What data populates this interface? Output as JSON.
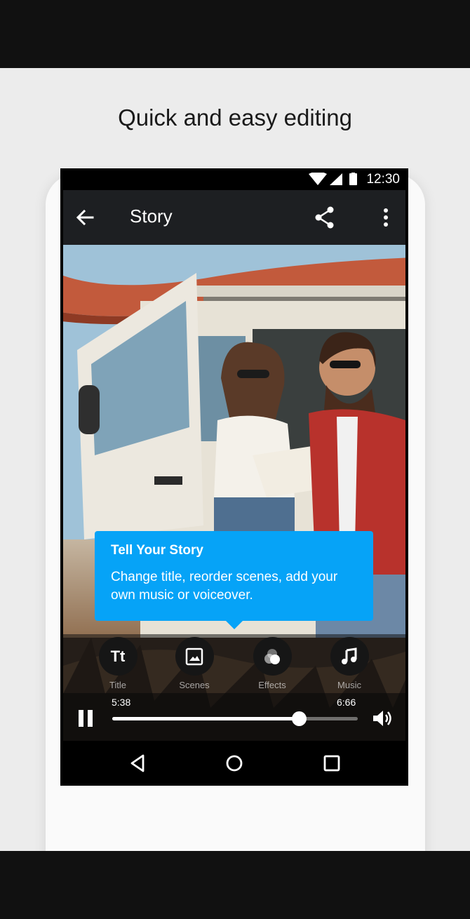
{
  "headline": "Quick and easy editing",
  "status_bar": {
    "time": "12:30",
    "icons": [
      "wifi-icon",
      "cell-signal-icon",
      "battery-icon"
    ]
  },
  "app_bar": {
    "title": "Story",
    "back_icon": "arrow-back-icon",
    "share_icon": "share-icon",
    "more_icon": "more-vert-icon"
  },
  "tooltip": {
    "title": "Tell Your Story",
    "body": "Change title, reorder scenes, add your own music or voiceover."
  },
  "tools": [
    {
      "label": "Title",
      "icon": "text-title-icon",
      "glyph": "Tt"
    },
    {
      "label": "Scenes",
      "icon": "image-icon"
    },
    {
      "label": "Effects",
      "icon": "effects-icon"
    },
    {
      "label": "Music",
      "icon": "music-note-icon"
    }
  ],
  "player": {
    "current_time": "5:38",
    "total_time": "6:66",
    "progress_fraction": 0.76
  },
  "colors": {
    "accent": "#06a3f7",
    "app_bar": "#1d1f22",
    "background": "#ececec",
    "frame": "#111111"
  }
}
